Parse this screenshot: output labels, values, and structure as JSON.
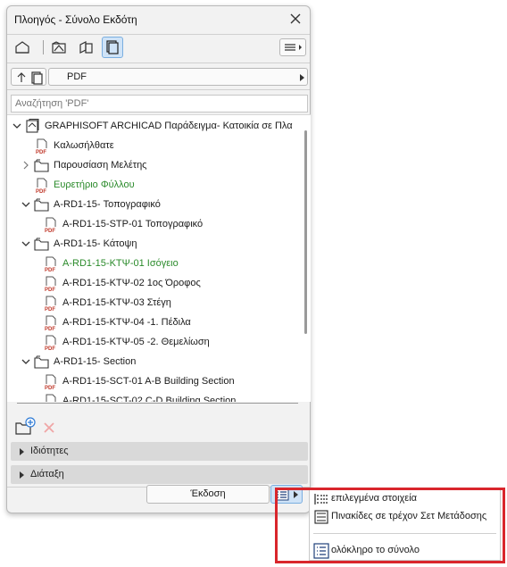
{
  "window": {
    "title": "Πλοηγός - Σύνολο Εκδότη"
  },
  "set": {
    "name": "PDF"
  },
  "search": {
    "placeholder": "Αναζήτηση 'PDF'"
  },
  "tree": [
    {
      "label": "GRAPHISOFT ARCHICAD Παράδειγμα- Κατοικία σε Πλα",
      "level": 0,
      "chevron": "down",
      "icon": "project-folder-icon",
      "color": "default"
    },
    {
      "label": "Καλωσήλθατε",
      "level": 1,
      "chevron": "none",
      "icon": "pdf-icon",
      "color": "default"
    },
    {
      "label": "Παρουσίαση Μελέτης",
      "level": 1,
      "chevron": "right",
      "icon": "folder-icon",
      "color": "default"
    },
    {
      "label": "Ευρετήριο Φύλλου",
      "level": 1,
      "chevron": "none",
      "icon": "pdf-icon",
      "color": "green"
    },
    {
      "label": "A-RD1-15- Τοπογραφικό",
      "level": 1,
      "chevron": "down",
      "icon": "folder-icon",
      "color": "default"
    },
    {
      "label": "A-RD1-15-STP-01 Τοπογραφικό",
      "level": 2,
      "chevron": "none",
      "icon": "pdf-icon",
      "color": "default"
    },
    {
      "label": "A-RD1-15- Κάτοψη",
      "level": 1,
      "chevron": "down",
      "icon": "folder-icon",
      "color": "default"
    },
    {
      "label": "A-RD1-15-ΚΤΨ-01 Ισόγειο",
      "level": 2,
      "chevron": "none",
      "icon": "pdf-icon",
      "color": "green"
    },
    {
      "label": "A-RD1-15-ΚΤΨ-02 1ος Όροφος",
      "level": 2,
      "chevron": "none",
      "icon": "pdf-icon",
      "color": "default"
    },
    {
      "label": "A-RD1-15-ΚΤΨ-03 Στέγη",
      "level": 2,
      "chevron": "none",
      "icon": "pdf-icon",
      "color": "default"
    },
    {
      "label": "A-RD1-15-ΚΤΨ-04 -1. Πέδιλα",
      "level": 2,
      "chevron": "none",
      "icon": "pdf-icon",
      "color": "default"
    },
    {
      "label": "A-RD1-15-ΚΤΨ-05 -2. Θεμελίωση",
      "level": 2,
      "chevron": "none",
      "icon": "pdf-icon",
      "color": "default"
    },
    {
      "label": "A-RD1-15- Section",
      "level": 1,
      "chevron": "down",
      "icon": "folder-icon",
      "color": "default"
    },
    {
      "label": "A-RD1-15-SCT-01 A-B Building Section",
      "level": 2,
      "chevron": "none",
      "icon": "pdf-icon",
      "color": "default"
    },
    {
      "label": "A-RD1-15-SCT-02 C-D Building Section",
      "level": 2,
      "chevron": "none",
      "icon": "pdf-icon",
      "color": "default"
    }
  ],
  "sections": {
    "properties": "Ιδιότητες",
    "layout": "Διάταξη"
  },
  "publish": {
    "label": "Έκδοση"
  },
  "menu": {
    "selected": "επιλεγμένα στοιχεία",
    "current_set": "Πινακίδες σε τρέχον Σετ Μετάδοσης",
    "whole": "ολόκληρο το σύνολο"
  },
  "colors": {
    "accent": "#cfe3f7",
    "green_label": "#2a8a2a",
    "highlight": "#d9262c",
    "pdf_red": "#c0392b"
  }
}
